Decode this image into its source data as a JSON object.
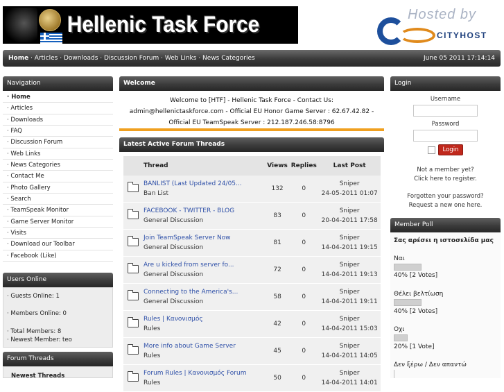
{
  "banner": {
    "title": "Hellenic Task Force"
  },
  "hosted": {
    "top": "Hosted by",
    "brand": "CITYHOST"
  },
  "topnav": {
    "links": [
      "Home",
      "Articles",
      "Downloads",
      "Discussion Forum",
      "Web Links",
      "News Categories"
    ],
    "date": "June 05 2011 17:14:14"
  },
  "navigation": {
    "title": "Navigation",
    "items": [
      "Home",
      "Articles",
      "Downloads",
      "FAQ",
      "Discussion Forum",
      "Web Links",
      "News Categories",
      "Contact Me",
      "Photo Gallery",
      "Search",
      "TeamSpeak Monitor",
      "Game Server Monitor",
      "Visits",
      "Download our Toolbar",
      "Facebook (Like)"
    ]
  },
  "users_online": {
    "title": "Users Online",
    "guests": "Guests Online: 1",
    "members": "Members Online: 0",
    "total": "Total Members: 8",
    "newest": "Newest Member: teo"
  },
  "forum_threads_panel": {
    "title": "Forum Threads",
    "sub": "Newest Threads"
  },
  "welcome": {
    "title": "Welcome",
    "text": "Welcome to [HTF] - Hellenic Task Force - Contact Us: admin@hellenictaskforce.com - Official EU Honor Game Server : 62.67.42.82 - Official EU TeamSpeak Server : 212.187.246.58:8796"
  },
  "latest": {
    "title": "Latest Active Forum Threads",
    "headers": {
      "thread": "Thread",
      "views": "Views",
      "replies": "Replies",
      "last_post": "Last Post"
    },
    "rows": [
      {
        "thread": "BANLIST (Last Updated 24/05...",
        "forum": "Ban List",
        "views": "132",
        "replies": "0",
        "user": "Sniper",
        "date": "24-05-2011 01:07"
      },
      {
        "thread": "FACEBOOK - TWITTER - BLOG",
        "forum": "General Discussion",
        "views": "83",
        "replies": "0",
        "user": "Sniper",
        "date": "20-04-2011 17:58"
      },
      {
        "thread": "Join TeamSpeak Server Now",
        "forum": "General Discussion",
        "views": "81",
        "replies": "0",
        "user": "Sniper",
        "date": "14-04-2011 19:15"
      },
      {
        "thread": "Are u kicked from server fo...",
        "forum": "General Discussion",
        "views": "72",
        "replies": "0",
        "user": "Sniper",
        "date": "14-04-2011 19:13"
      },
      {
        "thread": "Connecting to the America's...",
        "forum": "General Discussion",
        "views": "58",
        "replies": "0",
        "user": "Sniper",
        "date": "14-04-2011 19:11"
      },
      {
        "thread": "Rules | Κανονισμός",
        "forum": "Rules",
        "views": "42",
        "replies": "0",
        "user": "Sniper",
        "date": "14-04-2011 15:03"
      },
      {
        "thread": "More info about Game Server",
        "forum": "Rules",
        "views": "45",
        "replies": "0",
        "user": "Sniper",
        "date": "14-04-2011 14:05"
      },
      {
        "thread": "Forum Rules | Κανονισμός Forum",
        "forum": "Rules",
        "views": "50",
        "replies": "0",
        "user": "Sniper",
        "date": "14-04-2011 14:01"
      }
    ]
  },
  "login": {
    "title": "Login",
    "username_label": "Username",
    "password_label": "Password",
    "button": "Login",
    "not_member": "Not a member yet?",
    "register": "Click here to register.",
    "forgot": "Forgotten your password?",
    "request": "Request a new one here."
  },
  "poll": {
    "title": "Member Poll",
    "question": "Σας αρέσει η ιστοσελίδα μας",
    "options": [
      {
        "label": "Ναι",
        "result": "40% [2 Votes]",
        "percent": 40
      },
      {
        "label": "Θέλει βελτίωση",
        "result": "40% [2 Votes]",
        "percent": 40
      },
      {
        "label": "Οχι",
        "result": "20% [1 Vote]",
        "percent": 20
      },
      {
        "label": "Δεν ξέρω / Δεν απαντώ",
        "result": "",
        "percent": 0
      }
    ]
  },
  "colors": {
    "accent_orange": "#f0a020",
    "link_blue": "#2f50a8",
    "login_red": "#c0281c"
  }
}
